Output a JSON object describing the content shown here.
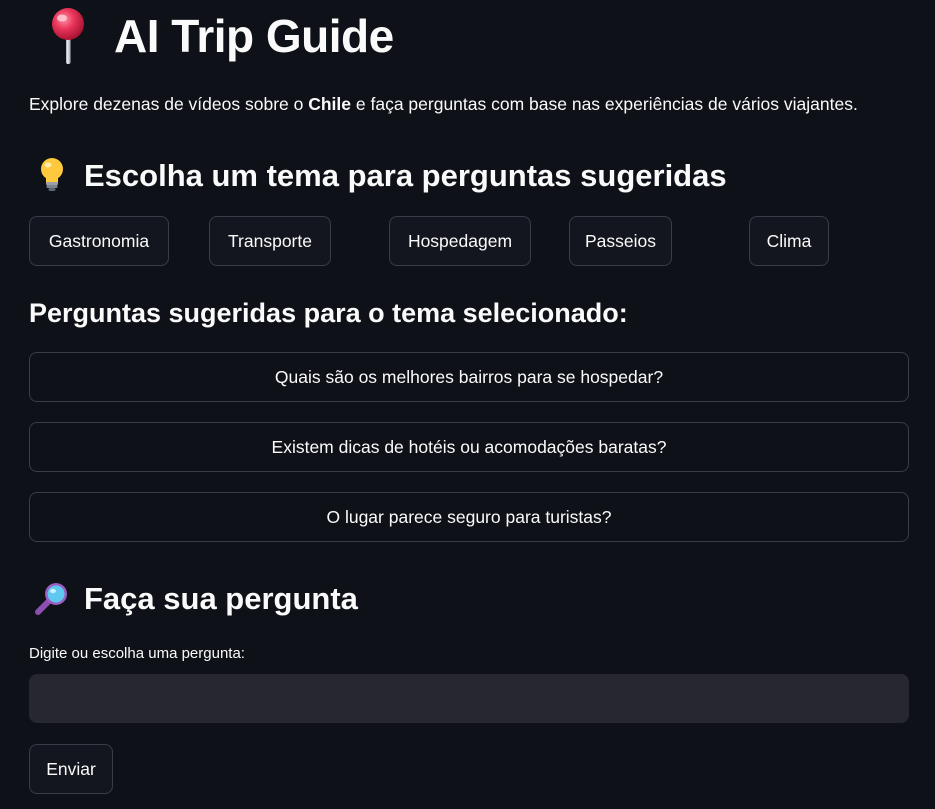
{
  "header": {
    "pin_icon": "round-pushpin-icon",
    "title": "AI Trip Guide"
  },
  "intro": {
    "before": "Explore dezenas de vídeos sobre o ",
    "highlight": "Chile",
    "after": " e faça perguntas com base nas experiências de vários viajantes."
  },
  "themes": {
    "icon": "light-bulb-icon",
    "heading": "Escolha um tema para perguntas sugeridas",
    "buttons": [
      "Gastronomia",
      "Transporte",
      "Hospedagem",
      "Passeios",
      "Clima"
    ]
  },
  "suggested": {
    "heading": "Perguntas sugeridas para o tema selecionado:",
    "questions": [
      "Quais são os melhores bairros para se hospedar?",
      "Existem dicas de hotéis ou acomodações baratas?",
      "O lugar parece seguro para turistas?"
    ]
  },
  "ask": {
    "icon": "magnifying-glass-icon",
    "heading": "Faça sua pergunta",
    "input_label": "Digite ou escolha uma pergunta:",
    "input_value": "",
    "submit_label": "Enviar"
  }
}
